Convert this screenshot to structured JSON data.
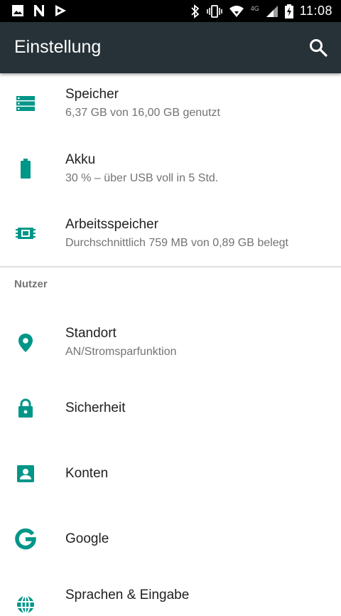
{
  "status_bar": {
    "time": "11:08",
    "network": "4G",
    "icons": [
      "image-icon",
      "n-icon",
      "play-icon",
      "bluetooth-icon",
      "vibrate-icon",
      "wifi-icon",
      "signal-icon",
      "battery-charging-icon"
    ]
  },
  "toolbar": {
    "title": "Einstellung",
    "search_icon": "search-icon"
  },
  "colors": {
    "accent": "#009688",
    "toolbar": "#263238",
    "title_text": "#212121",
    "summary_text": "#737373"
  },
  "device": {
    "items": [
      {
        "icon": "storage-icon",
        "title": "Speicher",
        "summary": "6,37 GB von 16,00 GB genutzt"
      },
      {
        "icon": "battery-icon",
        "title": "Akku",
        "summary": "30 % – über USB voll in 5 Std."
      },
      {
        "icon": "memory-icon",
        "title": "Arbeitsspeicher",
        "summary": "Durchschnittlich 759 MB von 0,89 GB belegt"
      }
    ]
  },
  "user_section": {
    "header": "Nutzer",
    "items": [
      {
        "icon": "location-icon",
        "title": "Standort",
        "summary": "AN/Stromsparfunktion"
      },
      {
        "icon": "lock-icon",
        "title": "Sicherheit"
      },
      {
        "icon": "account-icon",
        "title": "Konten"
      },
      {
        "icon": "google-icon",
        "title": "Google"
      },
      {
        "icon": "language-icon",
        "title": "Sprachen & Eingabe"
      }
    ]
  }
}
